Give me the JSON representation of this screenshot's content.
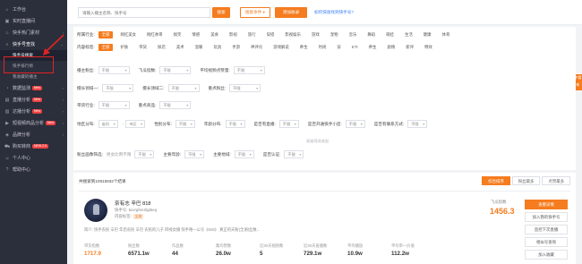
{
  "sidebar": {
    "items": [
      {
        "label": "工作台",
        "icon": "home-icon"
      },
      {
        "label": "实时直播间",
        "icon": "live-icon"
      },
      {
        "label": "快手热门素材",
        "icon": "fire-icon"
      },
      {
        "label": "快手号查找",
        "icon": "search-icon"
      },
      {
        "label": "数据监测",
        "icon": "monitor-icon",
        "badge": "New"
      },
      {
        "label": "直播分析",
        "icon": "chart-icon",
        "badge": "New"
      },
      {
        "label": "达播分析",
        "icon": "analytics-icon",
        "badge": "New"
      },
      {
        "label": "短视频商品分析",
        "icon": "video-icon",
        "badge": "New"
      },
      {
        "label": "品牌分析",
        "icon": "brand-icon"
      },
      {
        "label": "购买转商",
        "icon": "cart-icon",
        "badge": "NEW 2.0"
      },
      {
        "label": "个人中心",
        "icon": "user-icon"
      },
      {
        "label": "帮助中心",
        "icon": "help-icon"
      }
    ],
    "subitems": [
      "快手号搜索",
      "快手排行榜",
      "我收藏的播主"
    ]
  },
  "topbar": {
    "search_placeholder": "请输入播主名称、快手号",
    "search_button": "搜索",
    "advanced_button": "搜索条件 ▾",
    "add_button": "添加收录",
    "help_link": "如何快速找到快手号?"
  },
  "filters": {
    "industry_label": "所属行业:",
    "industry_chips": [
      "全部",
      "网红美女",
      "网红帅哥",
      "搞笑",
      "情感",
      "美食",
      "影视",
      "旅行",
      "穿搭",
      "影视娱乐",
      "游戏",
      "宠物",
      "音乐",
      "舞蹈",
      "萌娃",
      "生活",
      "健康",
      "体育"
    ],
    "content_label": "内容标签:",
    "content_chips": [
      "全部",
      "护肤",
      "带货",
      "探店",
      "美术",
      "温暖",
      "玩具",
      "手游",
      "神评论",
      "游戏解说",
      "养生",
      "时尚",
      "穿",
      "KTI",
      "养生",
      "剧情",
      "新评",
      "特效"
    ],
    "owner_label": "播主粉丝:",
    "fans_label": "飞瓜指数:",
    "gain_label": "平均视频点赞量:",
    "tag1_label": "擅长领域一:",
    "tag2_label": "擅长领域二:",
    "attention_label": "重点粉丝:",
    "sales_label": "带货行业:",
    "sales_cat_label": "重点商品:",
    "region_label": "地区分布:",
    "gender_label": "性别分布:",
    "age_label": "年龄分布:",
    "live_label": "是否有直播:",
    "shop_label": "是否开通快手小店:",
    "contact_label": "是否有联系方式:",
    "advanced_label": "粉丝画像筛选:",
    "advanced_hint": "男女比例不限",
    "fan_age_label": "主要年龄:",
    "fan_region_label": "主要地域:",
    "fan_platform_label": "是否认证:",
    "collapse_text": "高级筛选收起",
    "select_default": "不限",
    "province": "省份",
    "city": "市区",
    "dash": "-"
  },
  "side_tab": "中看新",
  "results": {
    "count_text": "共搜索到10915932个结果",
    "tabs": [
      "综合排序",
      "粉丝最多",
      "点赞最多"
    ],
    "card": {
      "name": "奈有志 辛巴 818",
      "id_line": "快手号: 5xxrgfen2tgt6eq",
      "category_line": "内容标签:",
      "category_tag": "女装",
      "intro": "简介: 快手农民 辛巴 年后农民 辛巴 农民的儿子 四线女播 快手唯一公号《818》 真正的天粉(全)粉丝数...",
      "score_label": "飞瓜指数",
      "score": "1456.3",
      "stats": [
        {
          "label": "带货指数",
          "value": "1717.9"
        },
        {
          "label": "粉丝数",
          "value": "6571.1w"
        },
        {
          "label": "作品数",
          "value": "44"
        },
        {
          "label": "集均赞数",
          "value": "26.0w"
        },
        {
          "label": "近30天视频数",
          "value": "5"
        },
        {
          "label": "近30天直播数",
          "value": "729.1w"
        },
        {
          "label": "平均播放",
          "value": "10.9w"
        },
        {
          "label": "平均单一价值",
          "value": "112.2w"
        }
      ],
      "actions": [
        "查看详情",
        "加入我的快手号",
        "监控下次直播",
        "相似号查询",
        "加入收藏"
      ]
    }
  },
  "colors": {
    "accent": "#f57c1f",
    "sidebar_bg": "#2b2e3b",
    "highlight": "#e02424"
  }
}
